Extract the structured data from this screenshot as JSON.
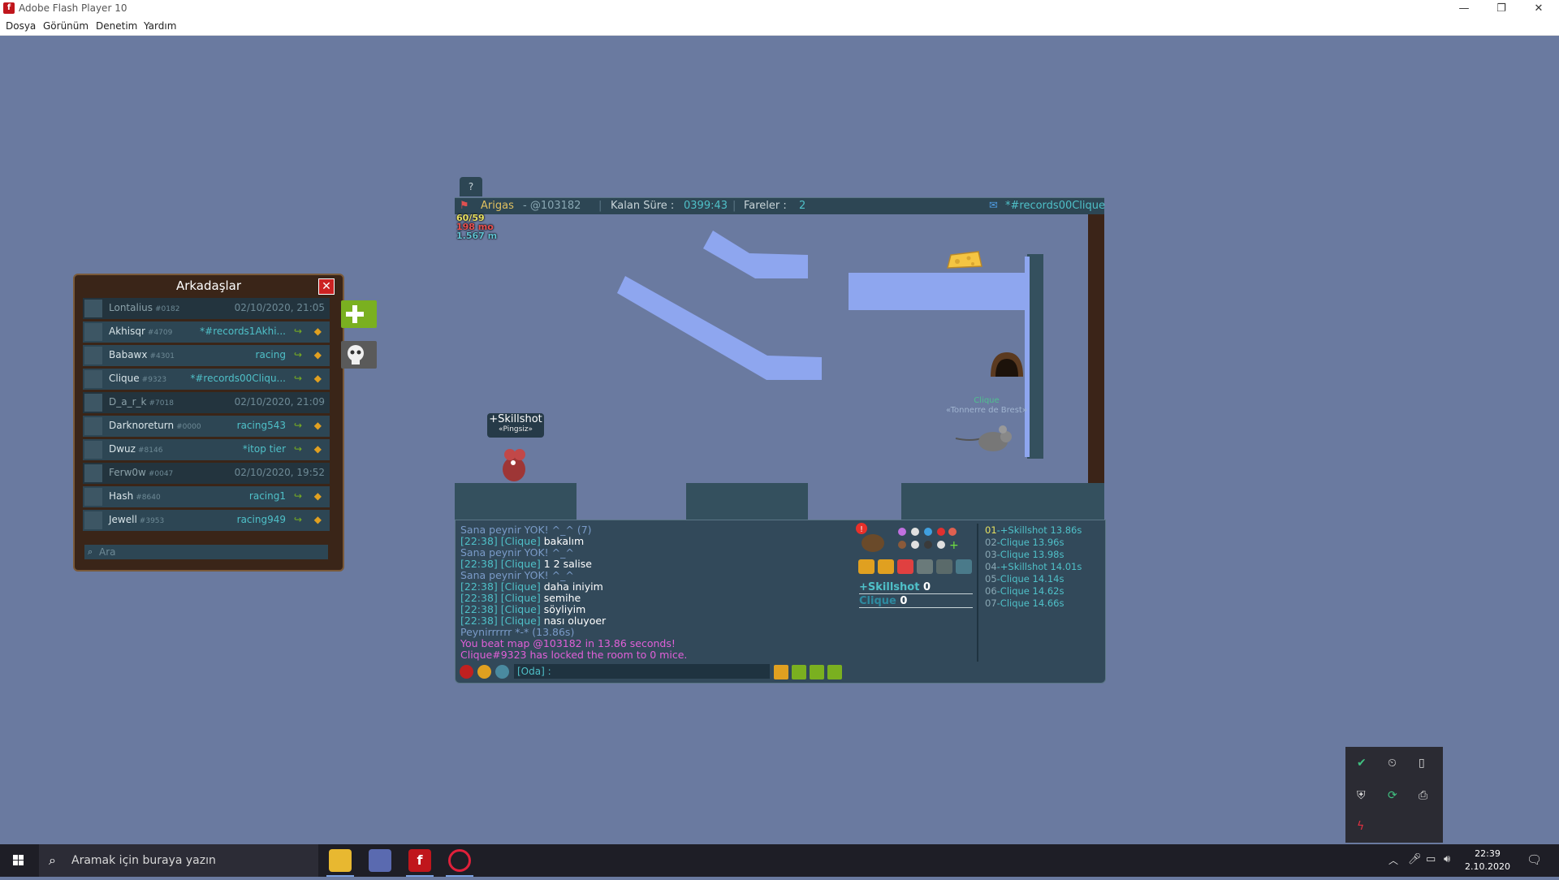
{
  "window": {
    "title": "Adobe Flash Player 10"
  },
  "menu": [
    "Dosya",
    "Görünüm",
    "Denetim",
    "Yardım"
  ],
  "game": {
    "help_label": "?",
    "map_author": "Arigas",
    "map_code": "- @103182",
    "time_label": "Kalan Süre :",
    "time_value": "0399:43",
    "mice_label": "Fareler :",
    "mice_value": "2",
    "room_name": "*#records00Clique",
    "stats": [
      "60/59",
      "198 mo",
      "1.567 m"
    ],
    "player_name": "+Skillshot",
    "player_title": "«Pingsiz»",
    "other_name": "Clique",
    "other_title": "«Tonnerre de Brest»",
    "chat": [
      {
        "text": "Sana peynir YOK! ^_^ (7)",
        "color": "#7a9bc8"
      },
      {
        "time": "[22:38] [Clique]",
        "text": "bakalım"
      },
      {
        "text": "Sana peynir YOK! ^_^",
        "color": "#7a9bc8"
      },
      {
        "time": "[22:38] [Clique]",
        "text": "1 2 salise"
      },
      {
        "text": "Sana peynir YOK! ^_^",
        "color": "#7a9bc8"
      },
      {
        "time": "[22:38] [Clique]",
        "text": "daha iniyim"
      },
      {
        "time": "[22:38] [Clique]",
        "text": "semihe"
      },
      {
        "time": "[22:38] [Clique]",
        "text": "söyliyim"
      },
      {
        "time": "[22:38] [Clique]",
        "text": "nası oluyoer"
      },
      {
        "text": "Peynirrrrrr *-* (13.86s)",
        "color": "#7a9bc8"
      },
      {
        "text": "You beat map @103182 in 13.86 seconds!",
        "color": "#e060d8"
      },
      {
        "text": "Clique#9323 has locked the room to 0 mice.",
        "color": "#e060d8"
      }
    ],
    "chat_placeholder": "[Oda] :",
    "scores": [
      {
        "name": "+Skillshot",
        "score": "0"
      },
      {
        "name": "Clique",
        "score": "0"
      }
    ],
    "ranking": [
      {
        "pos": "01",
        "text": "-+Skillshot 13.86s"
      },
      {
        "pos": "02",
        "text": "-Clique 13.96s"
      },
      {
        "pos": "03",
        "text": "-Clique 13.98s"
      },
      {
        "pos": "04",
        "text": "-+Skillshot 14.01s"
      },
      {
        "pos": "05",
        "text": "-Clique 14.14s"
      },
      {
        "pos": "06",
        "text": "-Clique 14.62s"
      },
      {
        "pos": "07",
        "text": "-Clique 14.66s"
      }
    ]
  },
  "friends": {
    "title": "Arkadaşlar",
    "search_placeholder": "Ara",
    "list": [
      {
        "name": "Lontalius",
        "tag": "#0182",
        "status": "02/10/2020, 21:05",
        "online": false
      },
      {
        "name": "Akhisqr",
        "tag": "#4709",
        "status": "*#records1Akhi...",
        "online": true
      },
      {
        "name": "Babawx",
        "tag": "#4301",
        "status": "racing",
        "online": true
      },
      {
        "name": "Clique",
        "tag": "#9323",
        "status": "*#records00Cliqu...",
        "online": true
      },
      {
        "name": "D_a_r_k",
        "tag": "#7018",
        "status": "02/10/2020, 21:09",
        "online": false
      },
      {
        "name": "Darknoreturn",
        "tag": "#0000",
        "status": "racing543",
        "online": true
      },
      {
        "name": "Dwuz",
        "tag": "#8146",
        "status": "*itop tier",
        "online": true
      },
      {
        "name": "Ferw0w",
        "tag": "#0047",
        "status": "02/10/2020, 19:52",
        "online": false
      },
      {
        "name": "Hash",
        "tag": "#8640",
        "status": "racing1",
        "online": true
      },
      {
        "name": "Jewell",
        "tag": "#3953",
        "status": "racing949",
        "online": true
      }
    ]
  },
  "taskbar": {
    "search_placeholder": "Aramak için buraya yazın",
    "time": "22:39",
    "date": "2.10.2020"
  }
}
